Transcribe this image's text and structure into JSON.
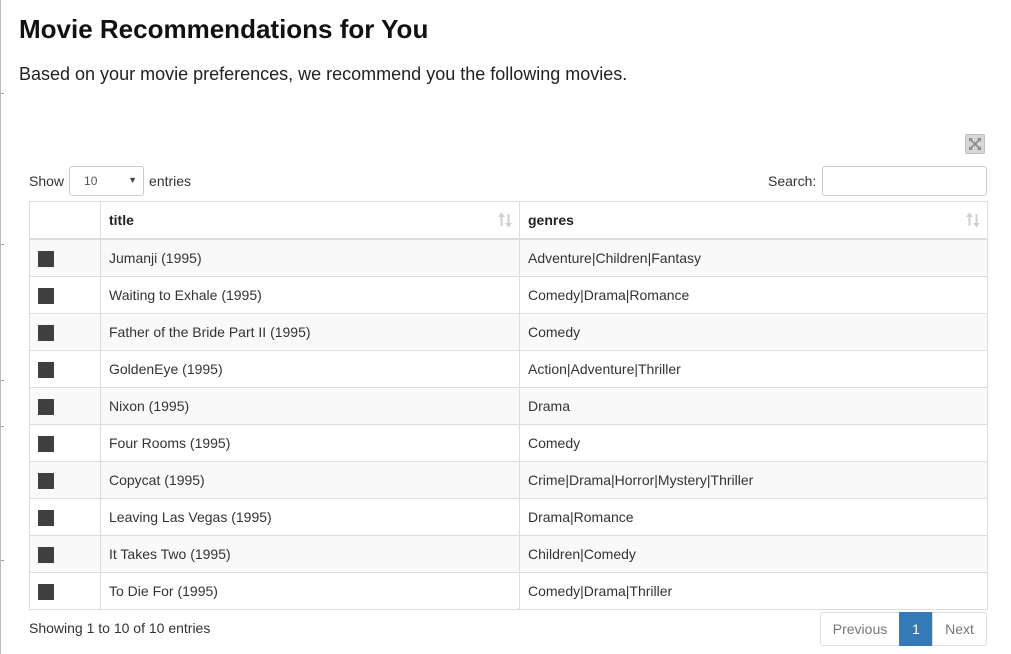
{
  "page": {
    "title": "Movie Recommendations for You",
    "subtitle": "Based on your movie preferences, we recommend you the following movies."
  },
  "controls": {
    "show_label": "Show",
    "length_value": "10",
    "entries_label": "entries",
    "search_label": "Search:",
    "search_value": ""
  },
  "table": {
    "columns": [
      "",
      "title",
      "genres"
    ],
    "rows": [
      {
        "title": "Jumanji (1995)",
        "genres": "Adventure|Children|Fantasy"
      },
      {
        "title": "Waiting to Exhale (1995)",
        "genres": "Comedy|Drama|Romance"
      },
      {
        "title": "Father of the Bride Part II (1995)",
        "genres": "Comedy"
      },
      {
        "title": "GoldenEye (1995)",
        "genres": "Action|Adventure|Thriller"
      },
      {
        "title": "Nixon (1995)",
        "genres": "Drama"
      },
      {
        "title": "Four Rooms (1995)",
        "genres": "Comedy"
      },
      {
        "title": "Copycat (1995)",
        "genres": "Crime|Drama|Horror|Mystery|Thriller"
      },
      {
        "title": "Leaving Las Vegas (1995)",
        "genres": "Drama|Romance"
      },
      {
        "title": "It Takes Two (1995)",
        "genres": "Children|Comedy"
      },
      {
        "title": "To Die For (1995)",
        "genres": "Comedy|Drama|Thriller"
      }
    ]
  },
  "footer": {
    "info": "Showing 1 to 10 of 10 entries",
    "previous_label": "Previous",
    "current_page": "1",
    "next_label": "Next"
  },
  "colors": {
    "accent": "#337ab7",
    "row_marker": "#3f3f3f",
    "striped_row": "#f9f9f9"
  },
  "icons": {
    "expand": "expand-icon",
    "sort": "sort-icon",
    "dropdown": "chevron-down-icon"
  }
}
